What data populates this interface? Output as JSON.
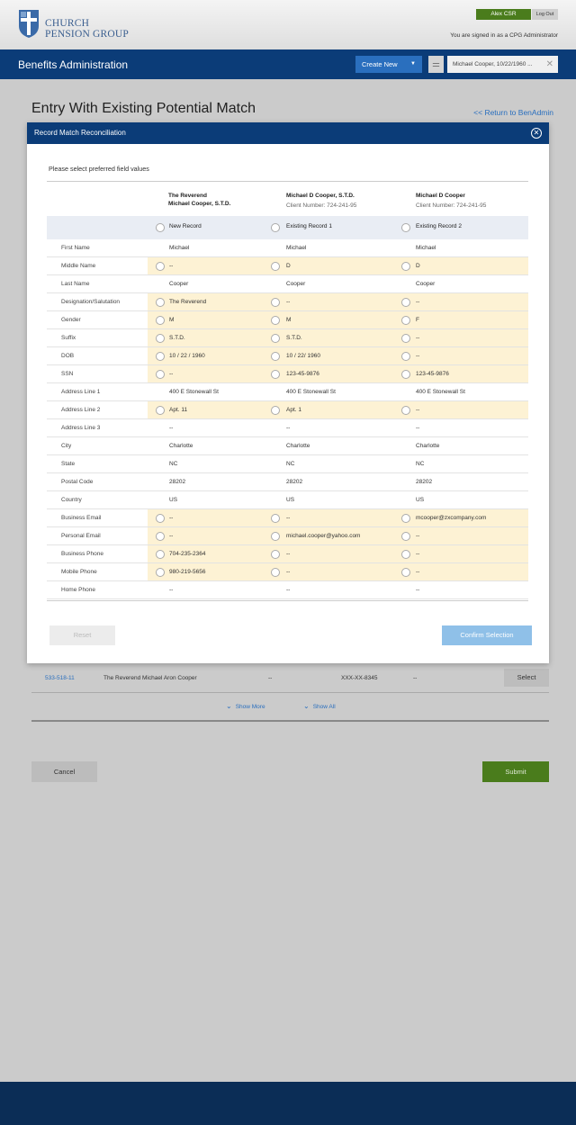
{
  "header": {
    "logo_line1": "CHURCH",
    "logo_line2": "PENSION GROUP",
    "user_name": "Alex CSR",
    "logout_label": "Log Out",
    "signed_in_text": "You are signed in as a CPG Administrator"
  },
  "nav": {
    "title": "Benefits Administration",
    "create_label": "Create New",
    "recent_record": "Michael Cooper, 10/22/1960 ..."
  },
  "page": {
    "title": "Entry With Existing Potential Match",
    "return_link": "<< Return to BenAdmin"
  },
  "modal": {
    "title": "Record Match Reconciliation",
    "instruction": "Please select preferred field values",
    "columns": [
      {
        "title_line1": "The Reverend",
        "title_line2": "Michael Cooper, S.T.D.",
        "option": "New Record"
      },
      {
        "title_line1": "Michael D Cooper, S.T.D.",
        "title_line2": "Client Number: 724-241-95",
        "option": "Existing Record 1"
      },
      {
        "title_line1": "Michael D Cooper",
        "title_line2": "Client Number: 724-241-95",
        "option": "Existing Record 2"
      }
    ],
    "fields": [
      {
        "label": "First Name",
        "values": [
          "Michael",
          "Michael",
          "Michael"
        ],
        "choice": false
      },
      {
        "label": "Middle Name",
        "values": [
          "--",
          "D",
          "D"
        ],
        "choice": true
      },
      {
        "label": "Last Name",
        "values": [
          "Cooper",
          "Cooper",
          "Cooper"
        ],
        "choice": false
      },
      {
        "label": "Designation/Salutation",
        "values": [
          "The Reverend",
          "--",
          "--"
        ],
        "choice": true
      },
      {
        "label": "Gender",
        "values": [
          "M",
          "M",
          "F"
        ],
        "choice": true
      },
      {
        "label": "Suffix",
        "values": [
          "S.T.D.",
          "S.T.D.",
          "--"
        ],
        "choice": true
      },
      {
        "label": "DOB",
        "values": [
          "10 / 22 / 1960",
          "10 / 22/ 1960",
          "--"
        ],
        "choice": true
      },
      {
        "label": "SSN",
        "values": [
          "--",
          "123-45-9876",
          "123-45-9876"
        ],
        "choice": true
      },
      {
        "label": "Address Line 1",
        "values": [
          "400 E Stonewall St",
          "400 E Stonewall St",
          "400 E Stonewall St"
        ],
        "choice": false
      },
      {
        "label": "Address Line 2",
        "values": [
          "Apt. 11",
          "Apt. 1",
          "--"
        ],
        "choice": true
      },
      {
        "label": "Address Line 3",
        "values": [
          "--",
          "--",
          "--"
        ],
        "choice": false
      },
      {
        "label": "City",
        "values": [
          "Charlotte",
          "Charlotte",
          "Charlotte"
        ],
        "choice": false
      },
      {
        "label": "State",
        "values": [
          "NC",
          "NC",
          "NC"
        ],
        "choice": false
      },
      {
        "label": "Postal Code",
        "values": [
          "28202",
          "28202",
          "28202"
        ],
        "choice": false
      },
      {
        "label": "Country",
        "values": [
          "US",
          "US",
          "US"
        ],
        "choice": false
      },
      {
        "label": "Business Email",
        "values": [
          "--",
          "--",
          "mcooper@zxcompany.com"
        ],
        "choice": true
      },
      {
        "label": "Personal Email",
        "values": [
          "--",
          "michael.cooper@yahoo.com",
          "--"
        ],
        "choice": true
      },
      {
        "label": "Business Phone",
        "values": [
          "704-235-2364",
          "--",
          "--"
        ],
        "choice": true
      },
      {
        "label": "Mobile Phone",
        "values": [
          "980-219-5656",
          "--",
          "--"
        ],
        "choice": true
      },
      {
        "label": "Home Phone",
        "values": [
          "--",
          "--",
          "--"
        ],
        "choice": false
      }
    ],
    "reset_label": "Reset",
    "confirm_label": "Confirm Selection"
  },
  "results": {
    "row": {
      "id": "533-518-11",
      "name": "The Reverend Michael Aron Cooper",
      "col3": "--",
      "ssn": "XXX-XX-8345",
      "col5": "--",
      "select_label": "Select"
    },
    "show_more": "Show More",
    "show_all": "Show All"
  },
  "actions": {
    "cancel_label": "Cancel",
    "submit_label": "Submit"
  }
}
